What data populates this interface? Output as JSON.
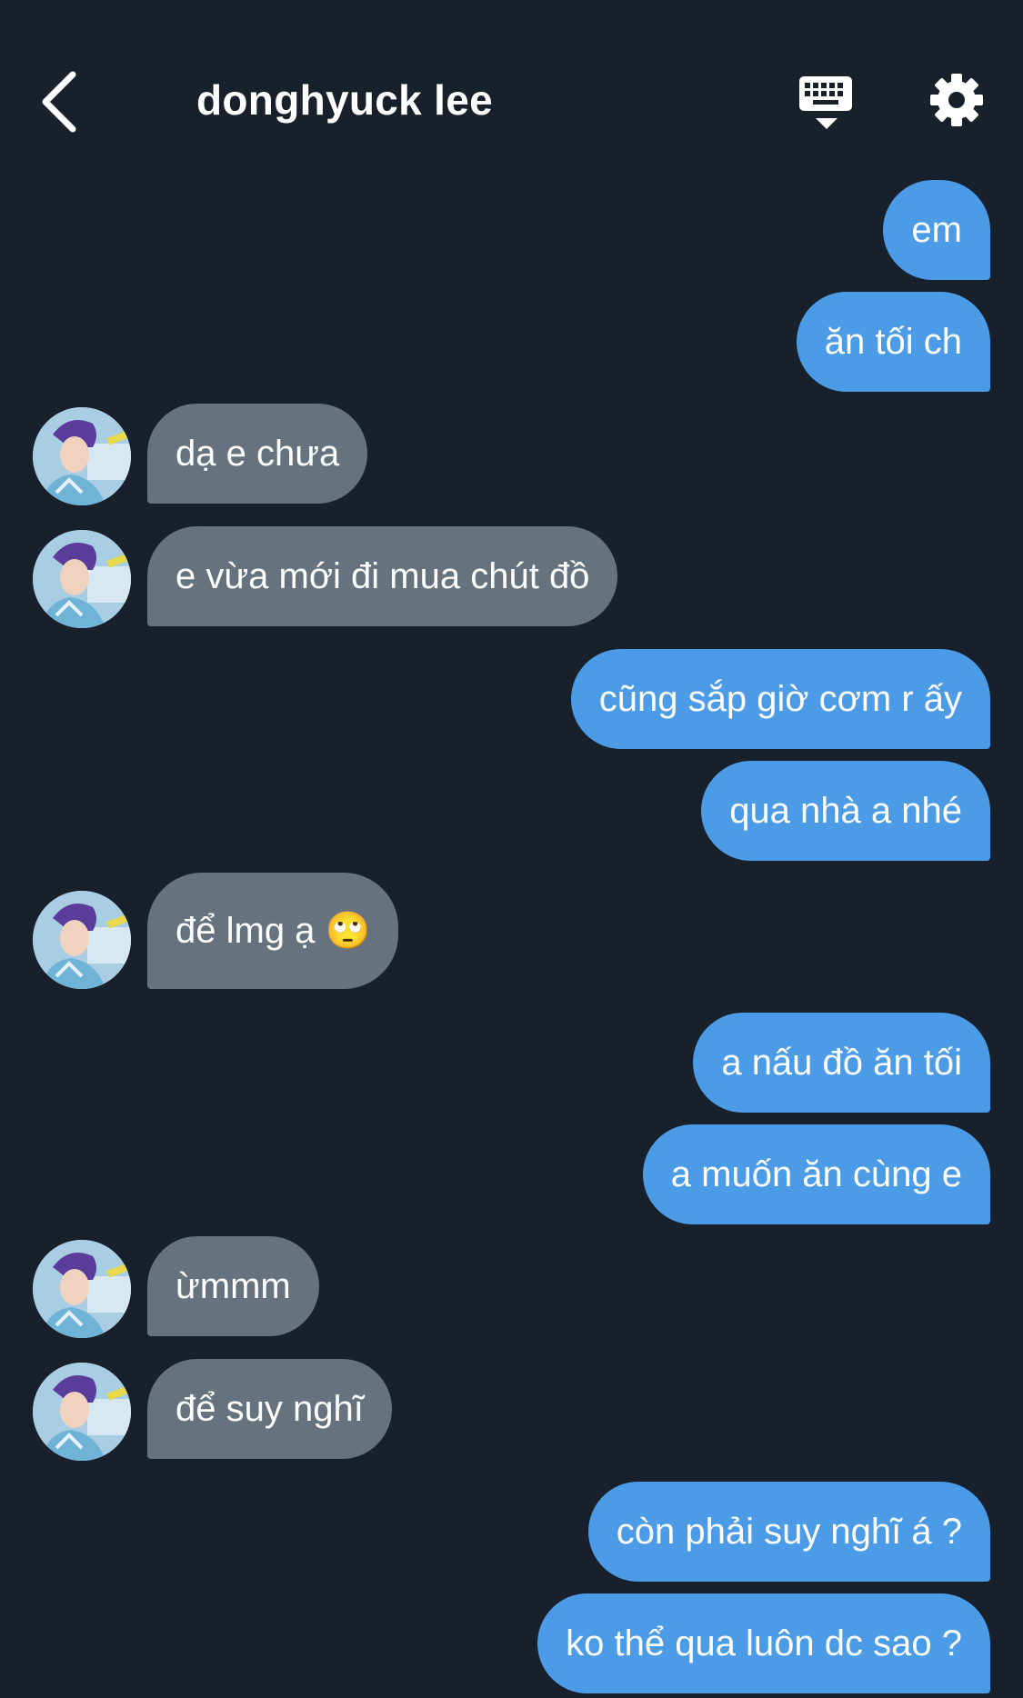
{
  "header": {
    "title": "donghyuck lee",
    "back_icon": "chevron-left-icon",
    "keyboard_icon": "keyboard-hide-icon",
    "settings_icon": "gear-icon"
  },
  "colors": {
    "background": "#17202b",
    "sent_bubble": "#4b9be6",
    "received_bubble": "#66737f",
    "text": "#ffffff"
  },
  "messages": [
    {
      "from": "me",
      "text": "em"
    },
    {
      "from": "me",
      "text": "ăn tối ch"
    },
    {
      "from": "them",
      "text": "dạ e chưa"
    },
    {
      "from": "them",
      "text": "e vừa mới đi mua chút đồ"
    },
    {
      "from": "me",
      "text": "cũng sắp giờ cơm r ấy"
    },
    {
      "from": "me",
      "text": "qua nhà a nhé"
    },
    {
      "from": "them",
      "text": "để lmg ạ 🙄"
    },
    {
      "from": "me",
      "text": "a nấu đồ ăn tối"
    },
    {
      "from": "me",
      "text": "a muốn ăn cùng e"
    },
    {
      "from": "them",
      "text": "ừmmm"
    },
    {
      "from": "them",
      "text": "để suy nghĩ"
    },
    {
      "from": "me",
      "text": "còn phải suy nghĩ á ?"
    },
    {
      "from": "me",
      "text": "ko thể qua luôn dc sao ?"
    }
  ]
}
